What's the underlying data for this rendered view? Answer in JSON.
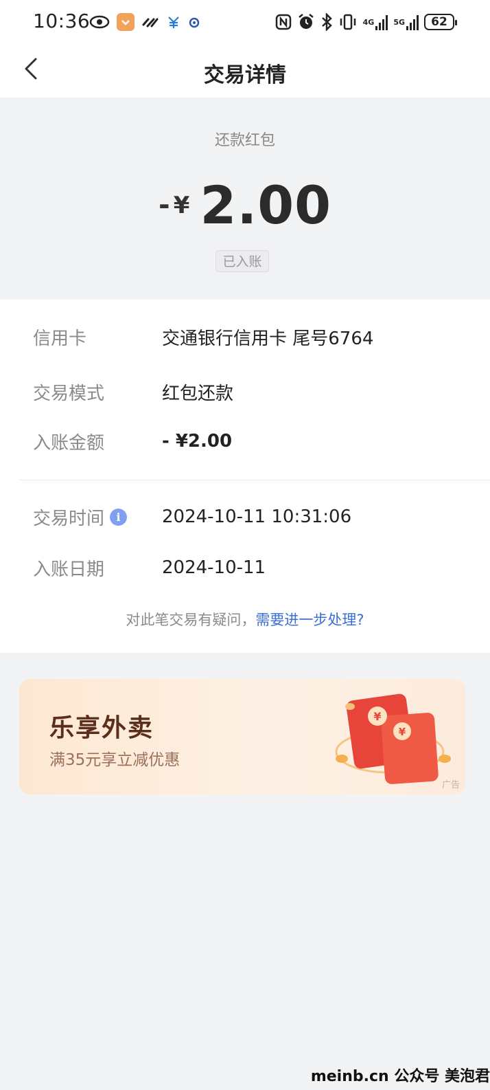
{
  "status_bar": {
    "time": "10:36",
    "battery": "62",
    "net_4g": "4G",
    "net_5g": "5G"
  },
  "nav": {
    "title": "交易详情"
  },
  "hero": {
    "subtitle": "还款红包",
    "sign": "-",
    "currency": "¥",
    "amount": "2.00",
    "badge": "已入账"
  },
  "details": {
    "card_label": "信用卡",
    "card_value": "交通银行信用卡 尾号6764",
    "mode_label": "交易模式",
    "mode_value": "红包还款",
    "amount_label": "入账金额",
    "amount_value": "- ¥2.00",
    "time_label": "交易时间",
    "time_value": "2024-10-11 10:31:06",
    "date_label": "入账日期",
    "date_value": "2024-10-11",
    "help_text": "对此笔交易有疑问，",
    "help_link": "需要进一步处理?"
  },
  "banner": {
    "title": "乐享外卖",
    "subtitle": "满35元享立减优惠",
    "ad": "广告"
  },
  "watermark": "meinb.cn 公众号 美泡君",
  "colors": {
    "page_bg": "#f2f3f5",
    "link": "#3b6fd4",
    "info_icon": "#7f9ff0",
    "banner_title": "#5a2e1a",
    "envelope_red": "#e8453a"
  },
  "icons": {
    "back": "chevron-left-icon",
    "info": "info-icon",
    "status_left": [
      "eye-icon",
      "app-badge-icon",
      "link-icon",
      "payment-icon",
      "app-icon"
    ],
    "status_right": [
      "nfc-icon",
      "alarm-icon",
      "bluetooth-icon",
      "vibrate-icon",
      "signal-icon",
      "battery-icon"
    ]
  }
}
